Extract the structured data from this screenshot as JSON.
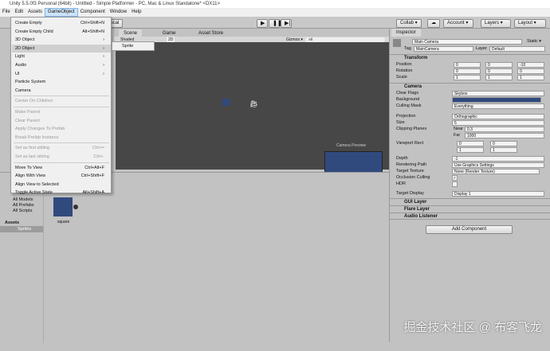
{
  "window_title": "Unity 5.5.0f3 Personal (64bit) - Untitled - Simple Platformer - PC, Mac & Linux Standalone* <DX11>",
  "menubar": [
    "File",
    "Edit",
    "Assets",
    "GameObject",
    "Component",
    "Window",
    "Help"
  ],
  "toolbar": {
    "local": "Local",
    "collab": "Collab ▾",
    "account": "Account ▾",
    "layers": "Layers ▾",
    "layout": "Layout ▾"
  },
  "scene": {
    "tabs": [
      "Scene",
      "Game",
      "Asset Store"
    ],
    "shading": "Shaded",
    "mode": "2D",
    "gizmos": "Gizmos ▾",
    "search": "All",
    "camera_preview": "Camera Preview"
  },
  "gameobject_menu": [
    {
      "label": "Create Empty",
      "shortcut": "Ctrl+Shift+N"
    },
    {
      "label": "Create Empty Child",
      "shortcut": "Alt+Shift+N"
    },
    {
      "label": "3D Object",
      "arrow": "›"
    },
    {
      "label": "2D Object",
      "arrow": "›"
    },
    {
      "label": "Light",
      "arrow": "›"
    },
    {
      "label": "Audio",
      "arrow": "›"
    },
    {
      "label": "UI",
      "arrow": "›"
    },
    {
      "label": "Particle System"
    },
    {
      "label": "Camera"
    },
    {
      "label": "Center On Children"
    },
    {
      "label": "Make Parent"
    },
    {
      "label": "Clear Parent"
    },
    {
      "label": "Apply Changes To Prefab"
    },
    {
      "label": "Break Prefab Instance"
    },
    {
      "label": "Set as first sibling",
      "shortcut": "Ctrl+="
    },
    {
      "label": "Set as last sibling",
      "shortcut": "Ctrl+-"
    },
    {
      "label": "Move To View",
      "shortcut": "Ctrl+Alt+F"
    },
    {
      "label": "Align With View",
      "shortcut": "Ctrl+Shift+F"
    },
    {
      "label": "Align View to Selected"
    },
    {
      "label": "Toggle Active State",
      "shortcut": "Alt+Shift+A"
    }
  ],
  "submenu": {
    "sprite": "Sprite"
  },
  "project": {
    "favorites": [
      "All Models",
      "All Prefabs",
      "All Scripts"
    ],
    "assets": "Assets",
    "sprites": "Sprites",
    "asset_name": "square"
  },
  "inspector": {
    "tab": "Inspector",
    "name": "Main Camera",
    "static": "Static ▾",
    "tag_label": "Tag",
    "tag": "MainCamera",
    "layer_label": "Layer",
    "layer": "Default",
    "transform": {
      "title": "Transform",
      "rows": [
        {
          "label": "Position",
          "x": "0",
          "y": "0",
          "z": "-10"
        },
        {
          "label": "Rotation",
          "x": "0",
          "y": "0",
          "z": "0"
        },
        {
          "label": "Scale",
          "x": "1",
          "y": "1",
          "z": "1"
        }
      ]
    },
    "camera": {
      "title": "Camera",
      "clear_flags_label": "Clear Flags",
      "clear_flags": "Skybox",
      "background_label": "Background",
      "culling_label": "Culling Mask",
      "culling": "Everything",
      "projection_label": "Projection",
      "projection": "Orthographic",
      "size_label": "Size",
      "size": "5",
      "clipping_label": "Clipping Planes",
      "near_label": "Near",
      "near": "0.3",
      "far_label": "Far",
      "far": "1000",
      "viewport_label": "Viewport Rect",
      "vx": "0",
      "vy": "0",
      "vw": "1",
      "vh": "1",
      "depth_label": "Depth",
      "depth": "-1",
      "rendering_label": "Rendering Path",
      "rendering": "Use Graphics Settings",
      "target_texture_label": "Target Texture",
      "target_texture": "None (Render Texture)",
      "occlusion_label": "Occlusion Culling",
      "hdr_label": "HDR",
      "display_label": "Target Display",
      "display": "Display 1"
    },
    "components": [
      "GUI Layer",
      "Flare Layer",
      "Audio Listener"
    ],
    "add_component": "Add Component"
  },
  "colors": {
    "background": "#314a7e",
    "dark_view": "#474747"
  },
  "watermark": "掘金技术社区 @ 布客飞龙"
}
